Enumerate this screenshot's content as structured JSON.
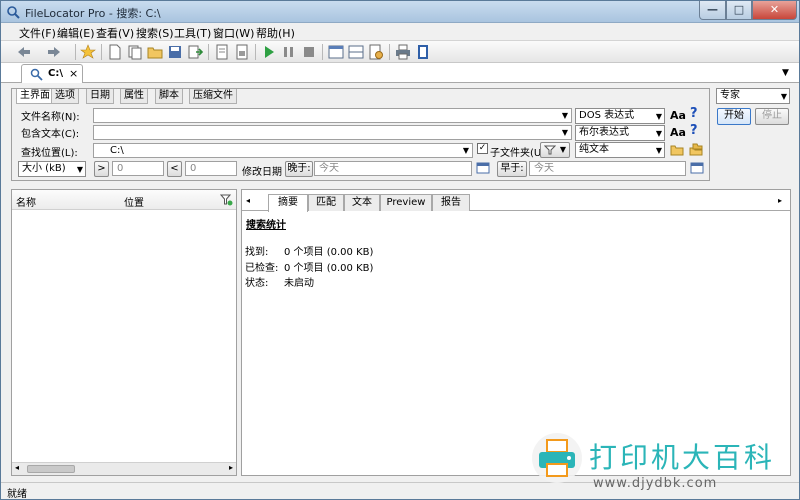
{
  "window": {
    "title": "FileLocator Pro - 搜索: C:\\"
  },
  "menu": [
    "文件(F)",
    "编辑(E)",
    "查看(V)",
    "搜索(S)",
    "工具(T)",
    "窗口(W)",
    "帮助(H)"
  ],
  "doc_tab": {
    "label": "C:\\",
    "close": "×"
  },
  "criteria": {
    "tabs": [
      "主界面",
      "选项",
      "日期",
      "属性",
      "脚本",
      "压缩文件"
    ],
    "filename_label": "文件名称(N):",
    "filename_value": "",
    "filename_mode": "DOS 表达式",
    "content_label": "包含文本(C):",
    "content_value": "",
    "content_mode": "布尔表达式",
    "location_label": "查找位置(L):",
    "location_value": "C:\\",
    "subfolders_label": "子文件夹(U)",
    "content_type": "纯文本",
    "size_combo": "大小 (kB)",
    "size_gt": ">",
    "size_gt_value": "0",
    "size_lt": "<",
    "size_lt_value": "0",
    "date_label": "修改日期",
    "after_btn": "晚于:",
    "after_value": "今天",
    "before_btn": "早于:",
    "before_value": "今天",
    "aa": "Aa",
    "help": "?"
  },
  "profile": {
    "value": "专家",
    "start": "开始",
    "stop": "停止"
  },
  "results": {
    "col_name": "名称",
    "col_location": "位置"
  },
  "detail": {
    "tabs": [
      "摘要",
      "匹配",
      "文本",
      "Preview",
      "报告"
    ],
    "stats_title": "搜索统计",
    "stats": [
      {
        "label": "找到:",
        "value": "0 个项目 (0.00 KB)"
      },
      {
        "label": "已检查:",
        "value": "0 个项目 (0.00 KB)"
      },
      {
        "label": "状态:",
        "value": "未启动"
      }
    ]
  },
  "status": {
    "text": "就绪"
  },
  "watermark": {
    "text": "打印机大百科",
    "url": "www.djydbk.com"
  }
}
